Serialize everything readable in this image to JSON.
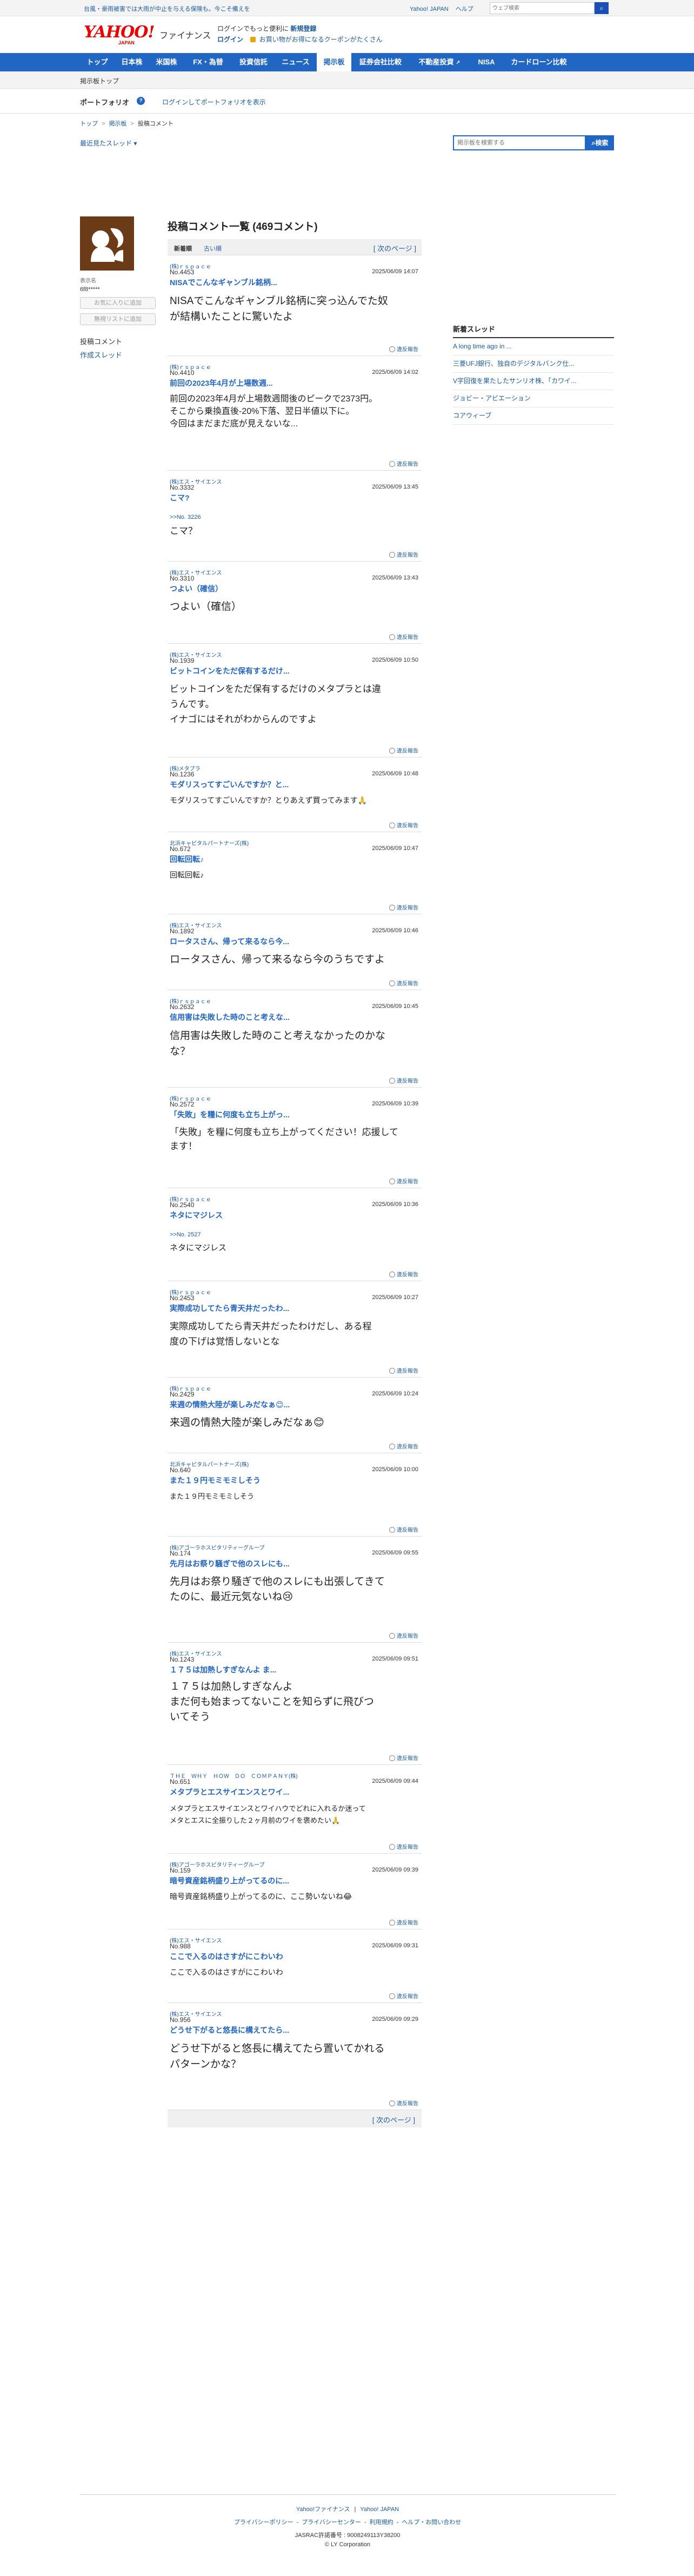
{
  "topbar": {
    "notice": "台風・豪雨被害では大雨が中止を与える保険も。今こそ備えを",
    "links": [
      "Yahoo! JAPAN",
      "ヘルプ"
    ],
    "search_placeholder": "ウェブ検索"
  },
  "header": {
    "logo_text": "YAHOO!",
    "logo_sub": "JAPAN",
    "service_name": "ファイナンス",
    "promo_line": "ログインでもっと便利に",
    "promo_highlight": "新規登録",
    "login_label": "ログイン",
    "coupon_text": "お買い物がお得になるクーポンがたくさん"
  },
  "nav": {
    "items": [
      "トップ",
      "日本株",
      "米国株",
      "FX・為替",
      "投資信託",
      "ニュース",
      "掲示板",
      "証券会社比較",
      "不動産投資",
      "NISA",
      "カードローン比較"
    ],
    "active_index": 6
  },
  "subbar": {
    "label": "掲示板トップ"
  },
  "portfolio": {
    "title": "ポートフォリオ",
    "help": "?",
    "login_link": "ログインしてポートフォリオを表示"
  },
  "breadcrumb": {
    "items": [
      "トップ",
      "掲示板",
      "投稿コメント"
    ],
    "sep": ">"
  },
  "recent_threads": "最近見たスレッド",
  "board_search": {
    "placeholder": "掲示板を検索する",
    "button": "検索"
  },
  "user": {
    "label": "表示名",
    "name": "6f8*****",
    "follow_button": "お気に入りに追加",
    "ignore_button": "無視リストに追加",
    "side_link_1": "投稿コメント",
    "side_link_2": "作成スレッド"
  },
  "main": {
    "title": "投稿コメント一覧 (469コメント)",
    "sort_new": "新着順",
    "sort_old": "古い順",
    "next_page": "[ 次のページ ]"
  },
  "comments": [
    {
      "stock": "(株)ｒｓｐａｃｅ",
      "no": "No.4453",
      "date": "2025/06/09 14:07",
      "title": "NISAでこんなギャンブル銘柄...",
      "reply": "",
      "body": "NISAでこんなギャンブル銘柄に突っ込んでた奴\nが結構いたことに驚いたよ",
      "report": "違反報告"
    },
    {
      "stock": "(株)ｒｓｐａｃｅ",
      "no": "No.4410",
      "date": "2025/06/09 14:02",
      "title": "前回の2023年4月が上場数週...",
      "reply": "",
      "body": "前回の2023年4月が上場数週間後のピークで2373円。\nそこから乗換直後-20%下落、翌日半値以下に。\n今回はまだまだ底が見えないな...",
      "report": "違反報告"
    },
    {
      "stock": "(株)エス・サイエンス",
      "no": "No.3332",
      "date": "2025/06/09 13:45",
      "title": "こマ?",
      "reply": ">>No. 3226",
      "body": "こマ？",
      "report": "違反報告"
    },
    {
      "stock": "(株)エス・サイエンス",
      "no": "No.3310",
      "date": "2025/06/09 13:43",
      "title": "つよい（確信）",
      "reply": "",
      "body": "つよい（確信）",
      "report": "違反報告"
    },
    {
      "stock": "(株)エス・サイエンス",
      "no": "No.1939",
      "date": "2025/06/09 10:50",
      "title": "ビットコインをただ保有するだけ...",
      "reply": "",
      "body": "ビットコインをただ保有するだけのメタプラとは違\nうんです。\nイナゴにはそれがわからんのですよ",
      "report": "違反報告"
    },
    {
      "stock": "(株)メタプラ",
      "no": "No.1236",
      "date": "2025/06/09 10:48",
      "title": "モダリスってすごいんですか？と...",
      "reply": "",
      "body": "モダリスってすごいんですか？とりあえず買ってみます🙏",
      "report": "違反報告"
    },
    {
      "stock": "北浜キャピタルパートナーズ(株)",
      "no": "No.672",
      "date": "2025/06/09 10:47",
      "title": "回転回転♪",
      "reply": "",
      "body": "回転回転♪",
      "report": "違反報告"
    },
    {
      "stock": "(株)エス・サイエンス",
      "no": "No.1892",
      "date": "2025/06/09 10:46",
      "title": "ロータスさん、帰って来るなら今...",
      "reply": "",
      "body": "ロータスさん、帰って来るなら今のうちですよ",
      "report": "違反報告"
    },
    {
      "stock": "(株)ｒｓｐａｃｅ",
      "no": "No.2632",
      "date": "2025/06/09 10:45",
      "title": "信用害は失敗した時のこと考えな...",
      "reply": "",
      "body": "信用害は失敗した時のこと考えなかったのかな\nな？",
      "report": "違反報告"
    },
    {
      "stock": "(株)ｒｓｐａｃｅ",
      "no": "No.2572",
      "date": "2025/06/09 10:39",
      "title": "「失敗」を糧に何度も立ち上がっ...",
      "reply": "",
      "body": "「失敗」を糧に何度も立ち上がってください！応援して\nます！",
      "report": "違反報告"
    },
    {
      "stock": "(株)ｒｓｐａｃｅ",
      "no": "No.2540",
      "date": "2025/06/09 10:36",
      "title": "ネタにマジレス",
      "reply": ">>No. 2527",
      "body": "ネタにマジレス",
      "report": "違反報告"
    },
    {
      "stock": "(株)ｒｓｐａｃｅ",
      "no": "No.2453",
      "date": "2025/06/09 10:27",
      "title": "実際成功してたら青天井だったわ...",
      "reply": "",
      "body": "実際成功してたら青天井だったわけだし、ある程\n度の下げは覚悟しないとな",
      "report": "違反報告"
    },
    {
      "stock": "(株)ｒｓｐａｃｅ",
      "no": "No.2429",
      "date": "2025/06/09 10:24",
      "title": "来週の情熱大陸が楽しみだなぁ😊...",
      "reply": "",
      "body": "来週の情熱大陸が楽しみだなぁ😊",
      "report": "違反報告"
    },
    {
      "stock": "北浜キャピタルパートナーズ(株)",
      "no": "No.640",
      "date": "2025/06/09 10:00",
      "title": "また１９円モミモミしそう",
      "reply": "",
      "body": "また１９円モミモミしそう",
      "report": "違反報告"
    },
    {
      "stock": "(株)アゴーラホスピタリティーグループ",
      "no": "No.174",
      "date": "2025/06/09 09:55",
      "title": "先月はお祭り騒ぎで他のスレにも...",
      "reply": "",
      "body": "先月はお祭り騒ぎで他のスレにも出張してきて\nたのに、最近元気ないね😢",
      "report": "違反報告"
    },
    {
      "stock": "(株)エス・サイエンス",
      "no": "No.1243",
      "date": "2025/06/09 09:51",
      "title": "１７５は加熱しすぎなんよ ま...",
      "reply": "",
      "body": "１７５は加熱しすぎなんよ\nまだ何も始まってないことを知らずに飛びつ\nいてそう",
      "report": "違反報告"
    },
    {
      "stock": "ＴＨＥ　ＷＨＹ　ＨＯＷ　ＤＯ　ＣＯＭＰＡＮＹ(株)",
      "no": "No.651",
      "date": "2025/06/09 09:44",
      "title": "メタプラとエスサイエンスとワイ...",
      "reply": "",
      "body": "メタプラとエスサイエンスとワイハウでどれに入れるか迷って\nメタとエスに全振りした２ヶ月前のワイを褒めたい🙏",
      "report": "違反報告"
    },
    {
      "stock": "(株)アゴーラホスピタリティーグループ",
      "no": "No.159",
      "date": "2025/06/09 09:39",
      "title": "暗号資産銘柄盛り上がってるのに...",
      "reply": "",
      "body": "暗号資産銘柄盛り上がってるのに、ここ勢いないね😂",
      "report": "違反報告"
    },
    {
      "stock": "(株)エス・サイエンス",
      "no": "No.988",
      "date": "2025/06/09 09:31",
      "title": "ここで入るのはさすがにこわいわ",
      "reply": "",
      "body": "ここで入るのはさすがにこわいわ",
      "report": "違反報告"
    },
    {
      "stock": "(株)エス・サイエンス",
      "no": "No.956",
      "date": "2025/06/09 09:29",
      "title": "どうせ下がると悠長に構えてたら...",
      "reply": "",
      "body": "どうせ下がると悠長に構えてたら置いてかれる\nパターンかな？",
      "report": "違反報告"
    }
  ],
  "new_threads": {
    "title": "新着スレッド",
    "items": [
      "A long time ago in ...",
      "三菱UFJ銀行、独自のデジタルバンク仕...",
      "V字回復を果たしたサンリオ株、「カワイ...",
      "ジョビー・アビエーション",
      "コアウィーブ"
    ]
  },
  "footer": {
    "links1": [
      "Yahoo!ファイナンス",
      "Yahoo! JAPAN"
    ],
    "links2": [
      "プライバシーポリシー",
      "プライバシーセンター",
      "利用規約",
      "ヘルプ・お問い合わせ"
    ],
    "jasrac": "JASRAC許諾番号 : 9008249113Y38200",
    "copyright": "© LY Corporation"
  }
}
